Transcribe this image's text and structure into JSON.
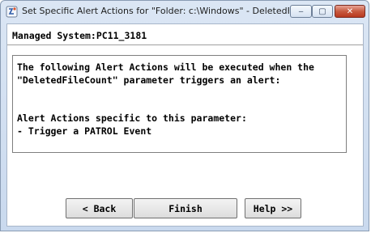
{
  "window": {
    "title": "Set Specific Alert Actions for \"Folder: c:\\Windows\" - DeletedFileC...",
    "controls": {
      "minimize": "‒",
      "maximize": "▢",
      "close": "✕"
    }
  },
  "header": {
    "managed_system": "Managed System:PC11_3181"
  },
  "message": {
    "line1": "The following Alert Actions will be executed when the",
    "line2": "\"DeletedFileCount\" parameter triggers an alert:",
    "line3": "Alert Actions specific to this parameter:",
    "line4": "- Trigger a PATROL Event"
  },
  "buttons": {
    "back": "< Back",
    "finish": "Finish",
    "help": "Help >>"
  },
  "colors": {
    "title_gradient_top": "#dbe6f4",
    "close_button": "#c75a40"
  }
}
